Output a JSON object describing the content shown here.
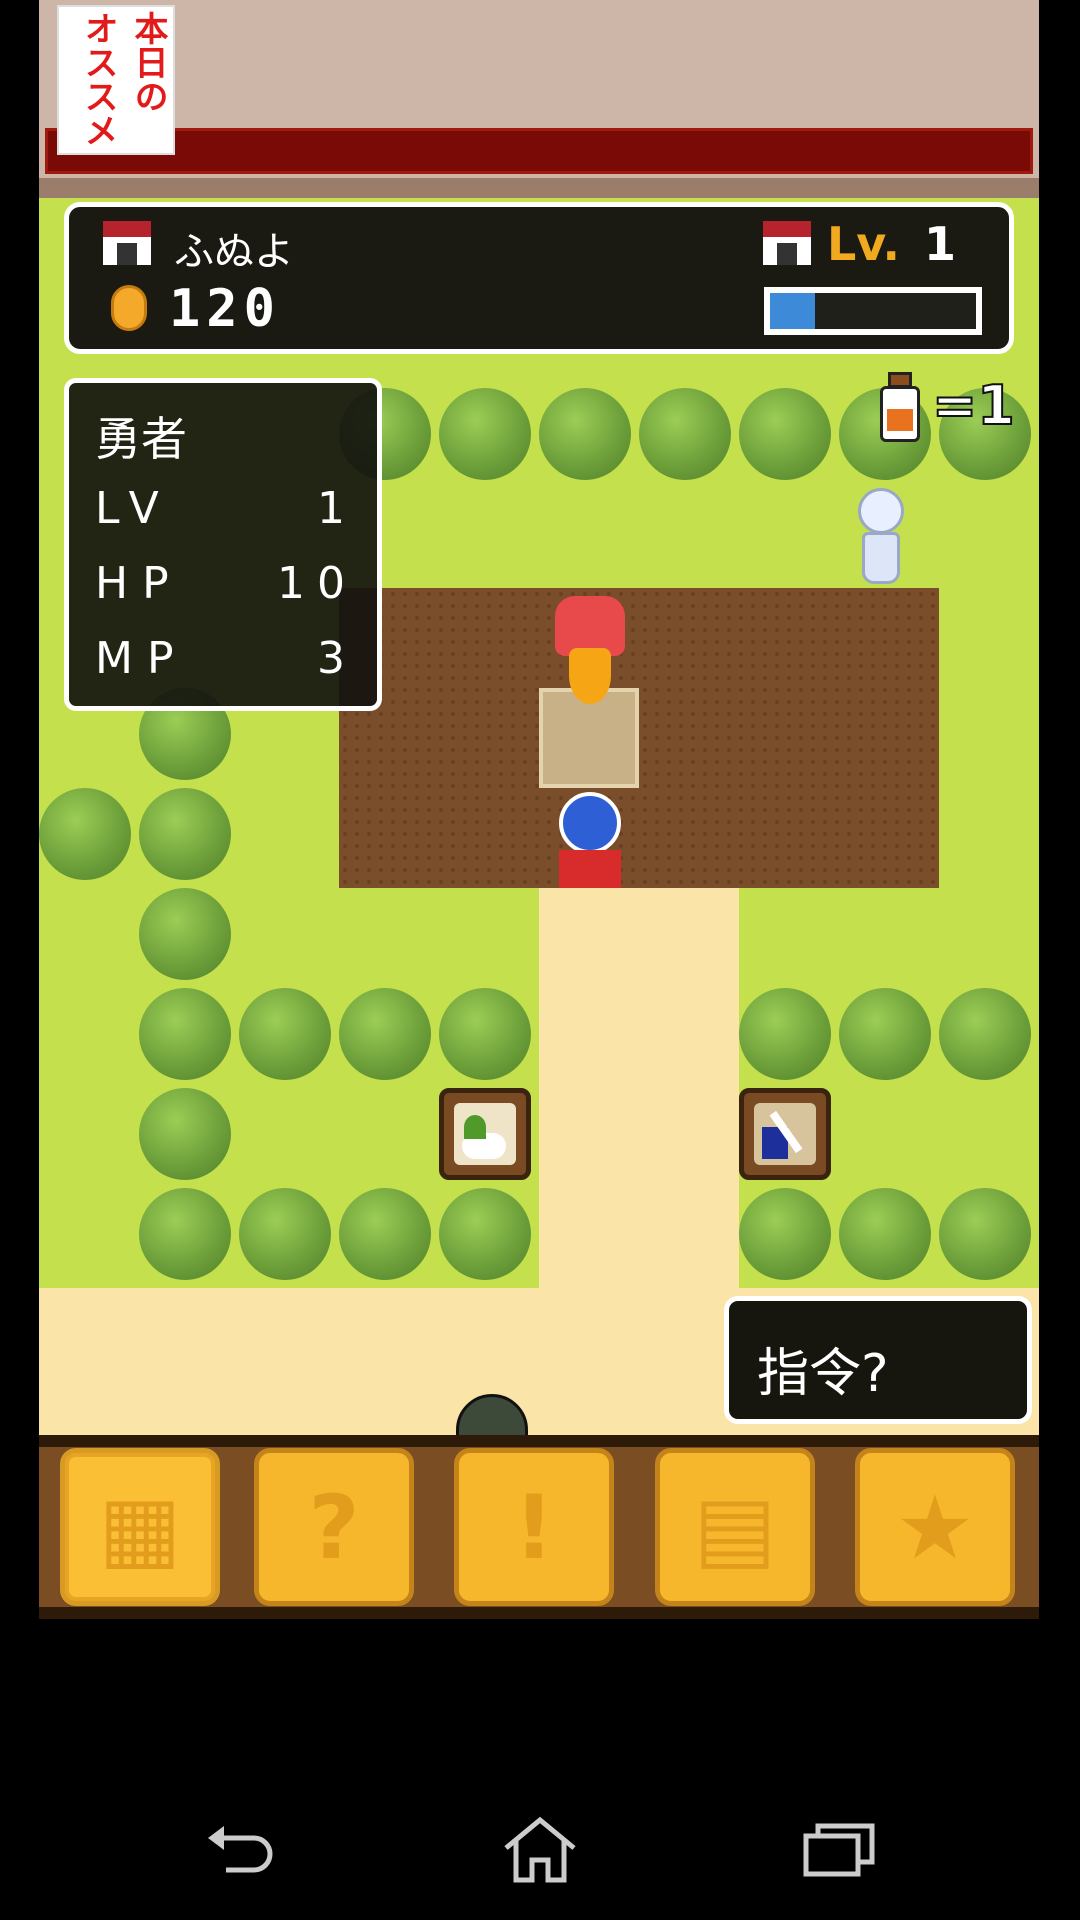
{
  "ad": {
    "logo_line1": "本日の",
    "logo_line2": "オススメ"
  },
  "hud": {
    "player_name": "ふぬよ",
    "coins": "120",
    "level_label": "Lv.",
    "level_value": "1",
    "xp_fraction": 0.22
  },
  "status": {
    "title": "勇者",
    "rows": [
      {
        "label": "LV",
        "value": "1"
      },
      {
        "label": "HP",
        "value": "10"
      },
      {
        "label": "MP",
        "value": "3"
      }
    ]
  },
  "potion": {
    "count_text": "=1"
  },
  "command": {
    "text": "指令?"
  },
  "toolbar": {
    "buttons": [
      {
        "icon": "shop-icon",
        "selected": true
      },
      {
        "icon": "question-hourglass-icon",
        "selected": false
      },
      {
        "icon": "event-icon",
        "selected": false
      },
      {
        "icon": "map-grid-icon",
        "selected": false
      },
      {
        "icon": "star-icon",
        "selected": false
      }
    ]
  },
  "colors": {
    "accent": "#f6b72c",
    "xp": "#3d8ad8",
    "grass": "#c4e04d"
  }
}
